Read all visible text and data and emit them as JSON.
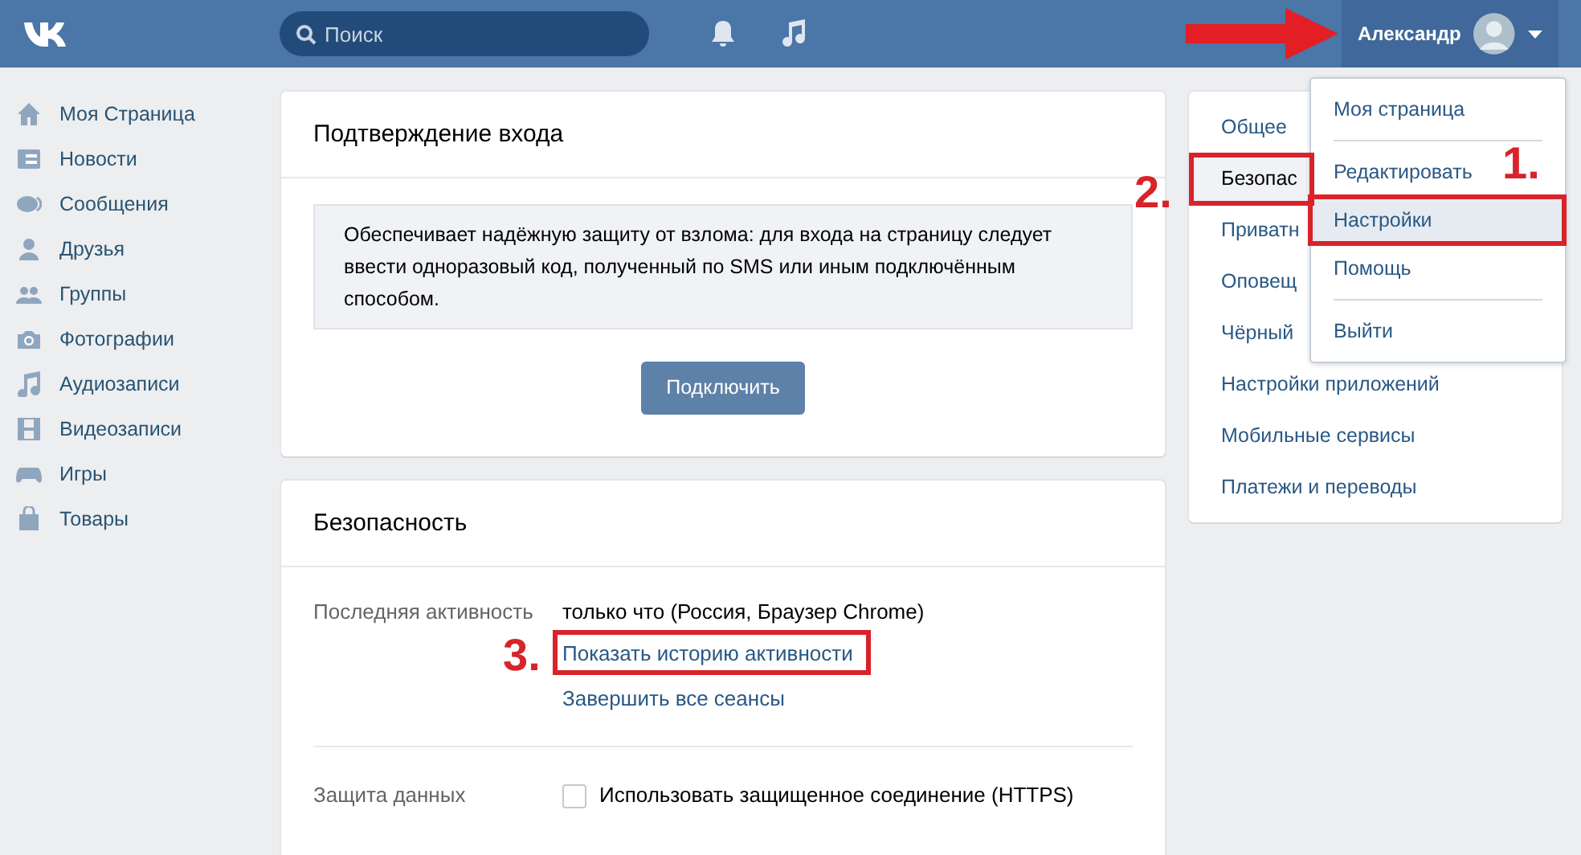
{
  "header": {
    "search": {
      "placeholder": "Поиск"
    },
    "user_name": "Александр"
  },
  "sidebar": {
    "items": [
      {
        "label": "Моя Страница"
      },
      {
        "label": "Новости"
      },
      {
        "label": "Сообщения"
      },
      {
        "label": "Друзья"
      },
      {
        "label": "Группы"
      },
      {
        "label": "Фотографии"
      },
      {
        "label": "Аудиозаписи"
      },
      {
        "label": "Видеозаписи"
      },
      {
        "label": "Игры"
      },
      {
        "label": "Товары"
      }
    ]
  },
  "login_confirmation": {
    "title": "Подтверждение входа",
    "info": "Обеспечивает надёжную защиту от взлома: для входа на страницу следует ввести одноразовый код, полученный по SMS или иным подключённым способом.",
    "button": "Подключить"
  },
  "security": {
    "title": "Безопасность",
    "last_activity": {
      "label": "Последняя активность",
      "value": "только что (Россия, Браузер Chrome)",
      "links": [
        "Показать историю активности",
        "Завершить все сеансы"
      ]
    },
    "data_protection": {
      "label": "Защита данных",
      "checkbox": "Использовать защищенное соединение (HTTPS)",
      "checked": false
    }
  },
  "settings_menu": {
    "items": [
      {
        "label": "Общее",
        "selected": false
      },
      {
        "label": "Безопас",
        "selected": true
      },
      {
        "label": "Приватн",
        "selected": false
      },
      {
        "label": "Оповещ",
        "selected": false
      },
      {
        "label": "Чёрный",
        "selected": false
      },
      {
        "label": "Настройки приложений",
        "selected": false
      },
      {
        "label": "Мобильные сервисы",
        "selected": false
      },
      {
        "label": "Платежи и переводы",
        "selected": false
      }
    ]
  },
  "user_dropdown": {
    "items": [
      {
        "label": "Моя страница",
        "selected": false,
        "divider_after": true
      },
      {
        "label": "Редактировать",
        "selected": false,
        "divider_after": false
      },
      {
        "label": "Настройки",
        "selected": true,
        "divider_after": false
      },
      {
        "label": "Помощь",
        "selected": false,
        "divider_after": true
      },
      {
        "label": "Выйти",
        "selected": false,
        "divider_after": false
      }
    ]
  },
  "annotations": [
    {
      "label": "1."
    },
    {
      "label": "2."
    },
    {
      "label": "3."
    }
  ]
}
